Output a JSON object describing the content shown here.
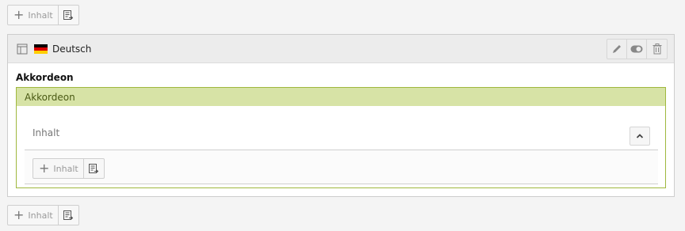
{
  "top_add": {
    "label": "Inhalt",
    "plus_icon": "plus-icon",
    "paste_icon": "paste-icon"
  },
  "element": {
    "language": "Deutsch",
    "title": "Akkordeon",
    "actions": [
      "edit-icon",
      "toggle-icon",
      "delete-icon"
    ],
    "accordion": {
      "header": "Akkordeon",
      "panel_title": "Inhalt",
      "inner_add_label": "Inhalt"
    }
  },
  "bottom_add": {
    "label": "Inhalt"
  },
  "colors": {
    "accordion_border": "#9fb83e",
    "accordion_header": "#d7e3a6"
  }
}
